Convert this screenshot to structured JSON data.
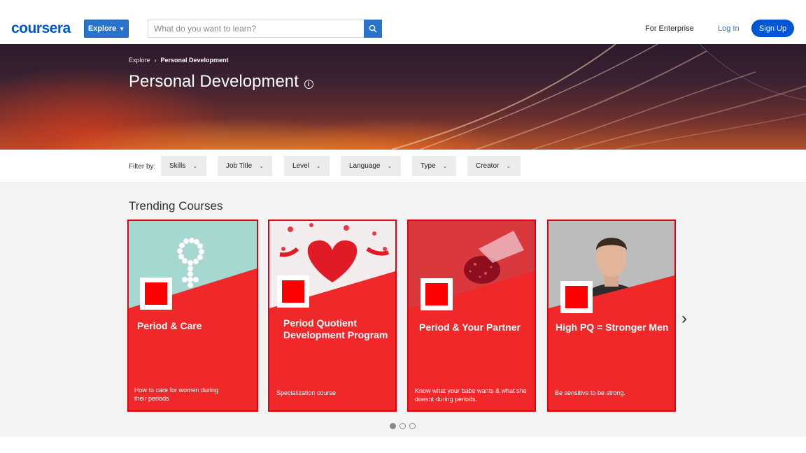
{
  "header": {
    "logo": "coursera",
    "explore_label": "Explore",
    "search_placeholder": "What do you want to learn?",
    "enterprise": "For Enterprise",
    "login": "Log In",
    "signup": "Sign Up"
  },
  "hero": {
    "breadcrumb": [
      "Explore",
      "Personal Development"
    ],
    "title": "Personal Development",
    "info_icon": "info-icon"
  },
  "filters": {
    "label": "Filter by:",
    "items": [
      "Skills",
      "Job Title",
      "Level",
      "Language",
      "Type",
      "Creator"
    ]
  },
  "trending": {
    "title": "Trending Courses",
    "cards": [
      {
        "title": "Period & Care",
        "description": "How to care for women during their periods"
      },
      {
        "title": "Period Quotient Development Program",
        "description": "Specialization course"
      },
      {
        "title": "Period & Your Partner",
        "description": "Know what your babe wants & what she doesnt during periods."
      },
      {
        "title": "High PQ = Stronger Men",
        "description": "Be sensitive to be strong."
      }
    ],
    "carousel_pages": 3,
    "active_page": 1
  },
  "colors": {
    "brand": "#0056d2",
    "card_red": "#f0282a",
    "card_border": "#e4000f"
  }
}
